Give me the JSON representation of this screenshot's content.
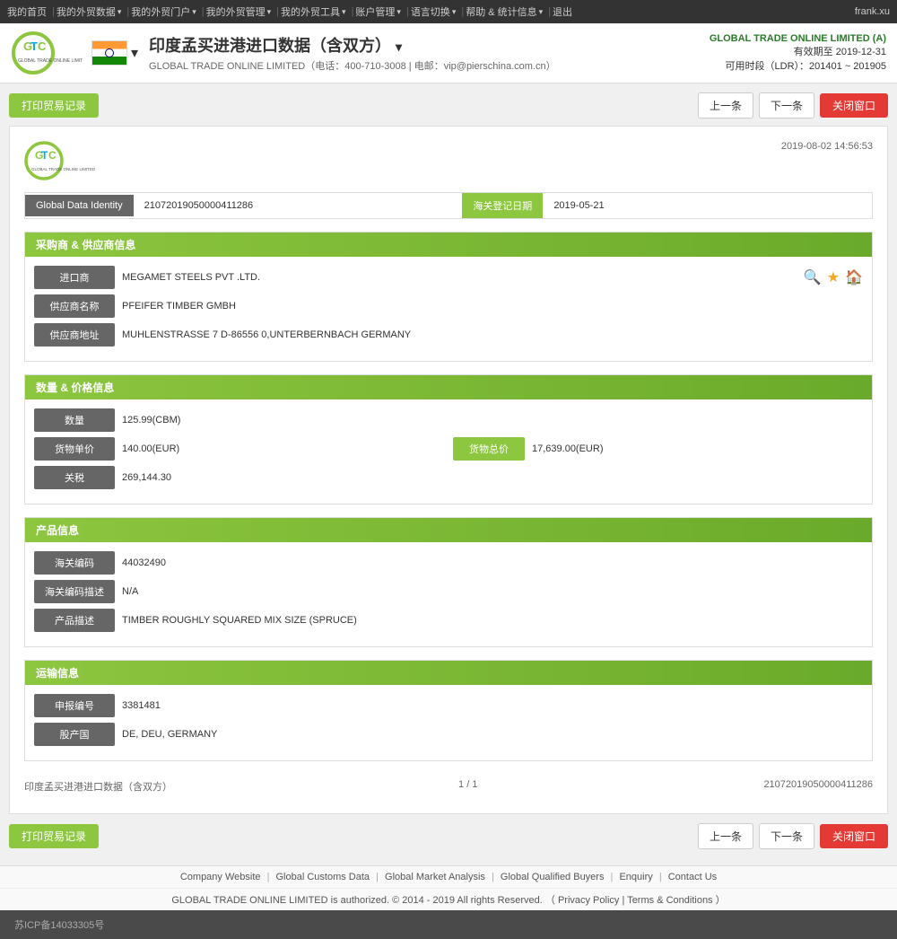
{
  "topnav": {
    "items": [
      {
        "label": "我的首页",
        "arrow": false
      },
      {
        "label": "我的外贸数据",
        "arrow": true
      },
      {
        "label": "我的外贸门户",
        "arrow": true
      },
      {
        "label": "我的外贸管理",
        "arrow": true
      },
      {
        "label": "我的外贸工具",
        "arrow": true
      },
      {
        "label": "账户管理",
        "arrow": true
      },
      {
        "label": "语言切换",
        "arrow": true
      },
      {
        "label": "帮助 & 统计信息",
        "arrow": true
      },
      {
        "label": "退出",
        "arrow": false
      }
    ],
    "user": "frank.xu"
  },
  "header": {
    "title": "印度孟买进港进口数据（含双方）",
    "arrow": "▾",
    "company_info": "GLOBAL TRADE ONLINE LIMITED（电话：400-710-3008 | 电邮：vip@pierschina.com.cn）",
    "right_company": "GLOBAL TRADE ONLINE LIMITED (A)",
    "right_valid": "有效期至 2019-12-31",
    "right_ldr": "可用时段（LDR）：201401 ~ 201905"
  },
  "toolbar": {
    "print_label": "打印贸易记录",
    "prev_label": "上一条",
    "next_label": "下一条",
    "close_label": "关闭窗口"
  },
  "card": {
    "datetime": "2019-08-02 14:56:53",
    "company_sub": "GLOBAL TRADE ONLINE LIMITED",
    "global_data_identity_label": "Global Data Identity",
    "global_data_identity_value": "21072019050000411286",
    "customs_date_label": "海关登记日期",
    "customs_date_value": "2019-05-21",
    "sections": {
      "buyer_supplier": {
        "title": "采购商 & 供应商信息",
        "fields": [
          {
            "label": "进口商",
            "value": "MEGAMET STEELS PVT .LTD.",
            "has_icons": true
          },
          {
            "label": "供应商名称",
            "value": "PFEIFER TIMBER GMBH",
            "has_icons": false
          },
          {
            "label": "供应商地址",
            "value": "MUHLENSTRASSE 7 D-86556 0,UNTERBERNBACH GERMANY",
            "has_icons": false
          }
        ]
      },
      "quantity_price": {
        "title": "数量 & 价格信息",
        "fields": [
          {
            "label": "数量",
            "value": "125.99(CBM)",
            "double": false
          },
          {
            "label": "货物单价",
            "value": "140.00(EUR)",
            "label2": "货物总价",
            "value2": "17,639.00(EUR)",
            "double": true
          },
          {
            "label": "关税",
            "value": "269,144.30",
            "double": false
          }
        ]
      },
      "product": {
        "title": "产品信息",
        "fields": [
          {
            "label": "海关编码",
            "value": "44032490"
          },
          {
            "label": "海关编码描述",
            "value": "N/A"
          },
          {
            "label": "产品描述",
            "value": "TIMBER ROUGHLY SQUARED MIX SIZE (SPRUCE)"
          }
        ]
      },
      "transport": {
        "title": "运输信息",
        "fields": [
          {
            "label": "申报编号",
            "value": "3381481"
          },
          {
            "label": "股产国",
            "value": "DE, DEU, GERMANY"
          }
        ]
      }
    }
  },
  "page_bottom": {
    "title": "印度孟买进港进口数据（含双方）",
    "page": "1 / 1",
    "id": "21072019050000411286"
  },
  "footer": {
    "links": [
      {
        "label": "Company Website"
      },
      {
        "label": "Global Customs Data"
      },
      {
        "label": "Global Market Analysis"
      },
      {
        "label": "Global Qualified Buyers"
      },
      {
        "label": "Enquiry"
      },
      {
        "label": "Contact Us"
      }
    ],
    "copy": "GLOBAL TRADE ONLINE LIMITED is authorized. © 2014 - 2019 All rights Reserved.  （",
    "privacy": "Privacy Policy",
    "sep": "|",
    "terms": "Terms & Conditions",
    "copy_end": "）"
  },
  "icp": {
    "label": "苏ICP备14033305号"
  }
}
